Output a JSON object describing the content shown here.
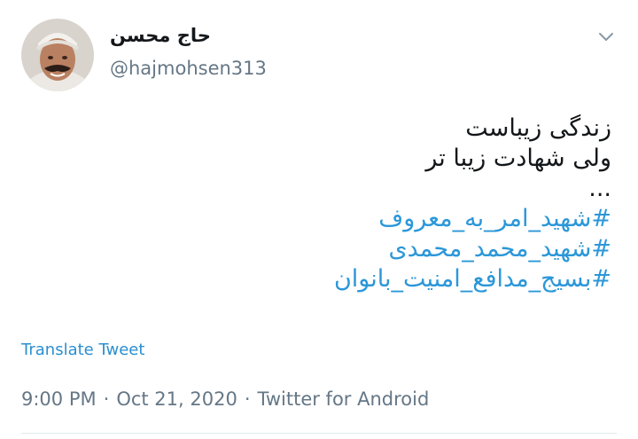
{
  "author": {
    "display_name": "حاج محسن",
    "handle": "@hajmohsen313"
  },
  "tweet": {
    "lines": [
      "زندگی زیباست",
      "ولی شهادت زیبا تر",
      "..."
    ],
    "hashtags": [
      "#شهید_امر_به_معروف",
      "#شهید_محمد_محمدی",
      "#بسیج_مدافع_امنیت_بانوان"
    ]
  },
  "translate_label": "Translate Tweet",
  "meta": {
    "time": "9:00 PM",
    "separator": "·",
    "date": "Oct 21, 2020",
    "source": "Twitter for Android"
  },
  "icons": {
    "menu": "chevron-down-icon"
  },
  "colors": {
    "hashtag": "#2b97d9",
    "link": "#2b8fd0",
    "secondary_text": "#657786"
  }
}
